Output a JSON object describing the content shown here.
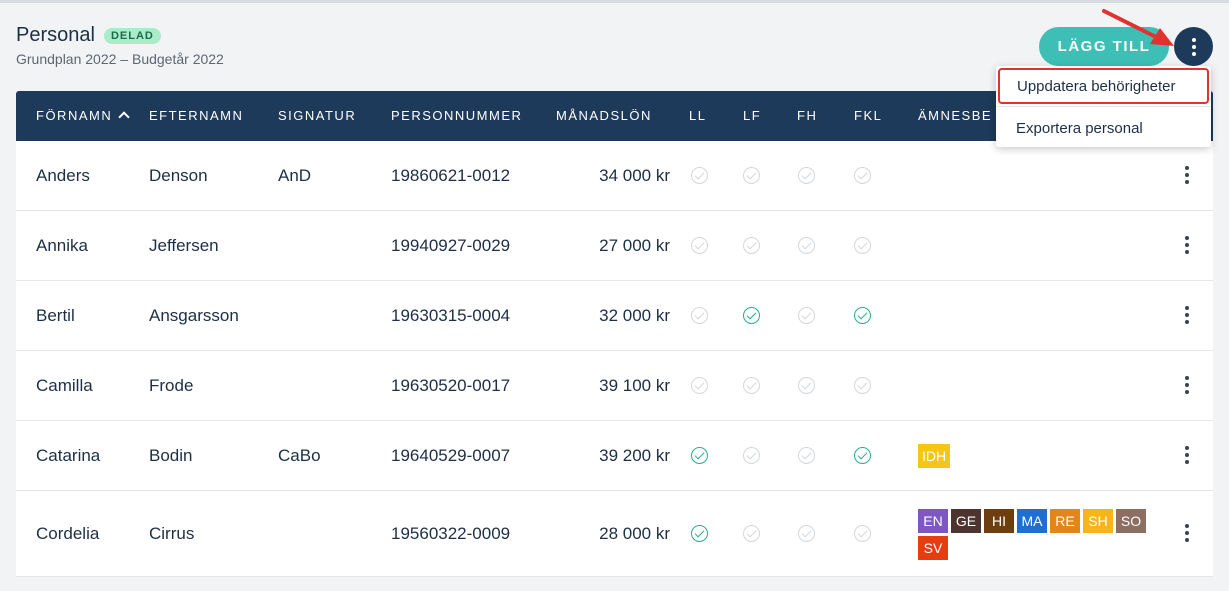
{
  "header": {
    "title": "Personal",
    "badge": "DELAD",
    "subtitle": "Grundplan 2022 – Budgetår 2022",
    "add_button": "LÄGG TILL"
  },
  "menu": {
    "items": [
      "Uppdatera behörigheter",
      "Exportera personal"
    ]
  },
  "table": {
    "columns": [
      "FÖRNAMN",
      "EFTERNAMN",
      "SIGNATUR",
      "PERSONNUMMER",
      "MÅNADSLÖN",
      "LL",
      "LF",
      "FH",
      "FKL",
      "ÄMNESBE"
    ],
    "rows": [
      {
        "first": "Anders",
        "last": "Denson",
        "signature": "AnD",
        "pnr": "19860621-0012",
        "salary": "34 000 kr",
        "ll": false,
        "lf": false,
        "fh": false,
        "fkl": false,
        "subjects": []
      },
      {
        "first": "Annika",
        "last": "Jeffersen",
        "signature": "",
        "pnr": "19940927-0029",
        "salary": "27 000 kr",
        "ll": false,
        "lf": false,
        "fh": false,
        "fkl": false,
        "subjects": []
      },
      {
        "first": "Bertil",
        "last": "Ansgarsson",
        "signature": "",
        "pnr": "19630315-0004",
        "salary": "32 000 kr",
        "ll": false,
        "lf": true,
        "fh": false,
        "fkl": true,
        "subjects": []
      },
      {
        "first": "Camilla",
        "last": "Frode",
        "signature": "",
        "pnr": "19630520-0017",
        "salary": "39 100 kr",
        "ll": false,
        "lf": false,
        "fh": false,
        "fkl": false,
        "subjects": []
      },
      {
        "first": "Catarina",
        "last": "Bodin",
        "signature": "CaBo",
        "pnr": "19640529-0007",
        "salary": "39 200 kr",
        "ll": true,
        "lf": false,
        "fh": false,
        "fkl": true,
        "subjects": [
          {
            "code": "IDH",
            "color": "#f5c518"
          }
        ]
      },
      {
        "first": "Cordelia",
        "last": "Cirrus",
        "signature": "",
        "pnr": "19560322-0009",
        "salary": "28 000 kr",
        "ll": true,
        "lf": false,
        "fh": false,
        "fkl": false,
        "subjects": [
          {
            "code": "EN",
            "color": "#7e57c2"
          },
          {
            "code": "GE",
            "color": "#4e342e"
          },
          {
            "code": "HI",
            "color": "#6d3f10"
          },
          {
            "code": "MA",
            "color": "#1e6fd0"
          },
          {
            "code": "RE",
            "color": "#e2861a"
          },
          {
            "code": "SH",
            "color": "#f7b51b"
          },
          {
            "code": "SO",
            "color": "#8d6e63"
          },
          {
            "code": "SV",
            "color": "#e53d12"
          }
        ]
      }
    ]
  },
  "colors": {
    "header_bg": "#1e3a5a",
    "accent": "#3dbfb6",
    "check_on": "#26b08e",
    "highlight": "#e0332f"
  }
}
